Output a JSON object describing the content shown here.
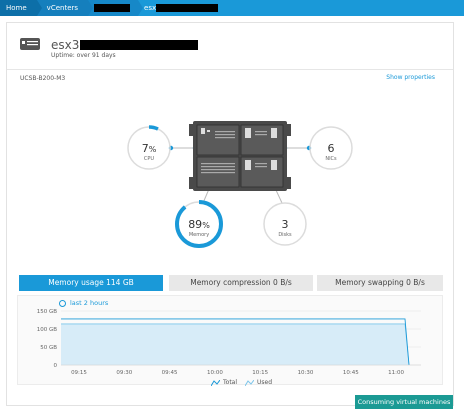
{
  "breadcrumb": {
    "home": "Home",
    "vcenters": "vCenters",
    "host_prefix": "esx"
  },
  "host": {
    "name": "esx3",
    "uptime": "Uptime: over 91 days",
    "model": "UCSB-B200-M3",
    "show_properties": "Show properties"
  },
  "metrics": {
    "cpu": {
      "value": "7",
      "unit": "%",
      "label": "CPU",
      "fraction": 0.07
    },
    "memory": {
      "value": "89",
      "unit": "%",
      "label": "Memory",
      "fraction": 0.89
    },
    "nics": {
      "value": "6",
      "label": "NICs"
    },
    "disks": {
      "value": "3",
      "label": "Disks"
    }
  },
  "tabs": [
    {
      "label": "Memory usage 114 GB",
      "active": true
    },
    {
      "label": "Memory compression 0 B/s",
      "active": false
    },
    {
      "label": "Memory swapping 0 B/s",
      "active": false
    }
  ],
  "time_range": "last 2 hours",
  "chart_data": {
    "type": "area",
    "x": [
      "09:15",
      "09:30",
      "09:45",
      "10:00",
      "10:15",
      "10:30",
      "10:45",
      "11:00"
    ],
    "y_ticks": [
      "150 GB",
      "100 GB",
      "50 GB",
      "0"
    ],
    "ylim": [
      0,
      150
    ],
    "series": [
      {
        "name": "Total",
        "values": [
          128,
          128,
          128,
          128,
          128,
          128,
          128,
          128,
          0
        ]
      },
      {
        "name": "Used",
        "values": [
          114,
          114,
          114,
          114,
          114,
          114,
          114,
          114,
          0
        ]
      }
    ],
    "legend_position": "bottom-center"
  },
  "buttons": {
    "consuming_vms": "Consuming virtual machines"
  },
  "colors": {
    "accent": "#1a99d8",
    "teal_button": "#1b9a94",
    "server": "#4a4a4a"
  }
}
